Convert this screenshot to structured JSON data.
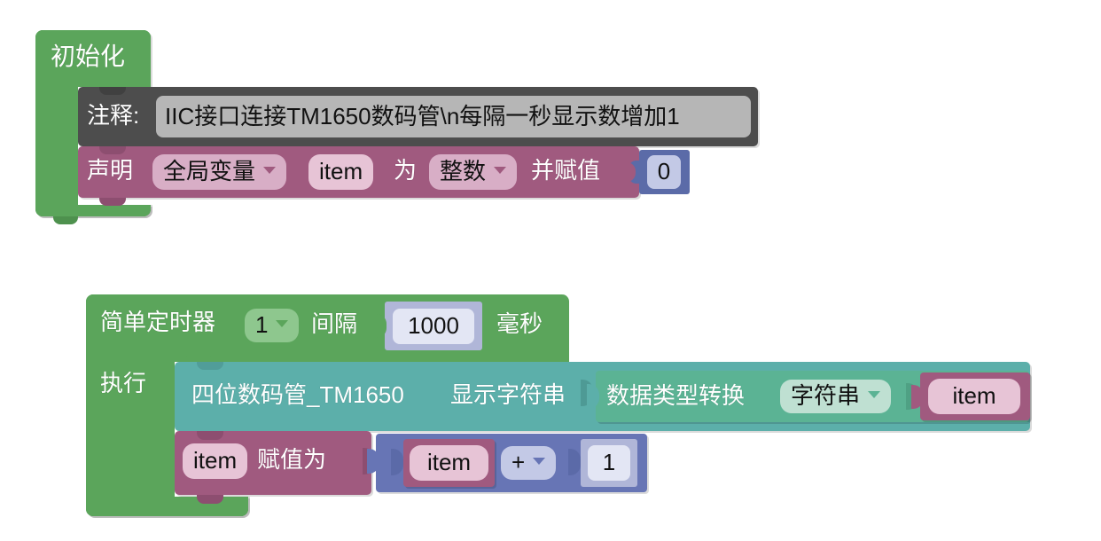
{
  "colors": {
    "event_green": "#5ba55b",
    "event_green_dark": "#4e914e",
    "comment_gray": "#4d4d4d",
    "comment_field": "#b6b6b6",
    "variable_pink": "#a05a7f",
    "variable_field": "#d8aec6",
    "math_blue": "#6775b5",
    "math_field": "#c3c9e6",
    "math_field_inner": "#dfe3f2",
    "device_teal": "#5cafaa",
    "convert_teal": "#5bb394",
    "convert_field": "#bfe0d2",
    "canvas_white": "#ffffff"
  },
  "init_block": {
    "title": "初始化",
    "comment_row": {
      "label": "注释:",
      "value": "IIC接口连接TM1650数码管\\n每隔一秒显示数增加1"
    },
    "declare_row": {
      "keyword": "声明",
      "scope": "全局变量",
      "var_name": "item",
      "as_label": "为",
      "type": "整数",
      "assign_label": "并赋值",
      "value": "0"
    }
  },
  "timer_block": {
    "title": "简单定时器",
    "timer_id": "1",
    "interval_label": "间隔",
    "interval_value": "1000",
    "unit_label": "毫秒",
    "do_label": "执行",
    "statements": [
      {
        "kind": "device-display",
        "device": "四位数码管_TM1650",
        "action": "显示字符串",
        "argument": {
          "kind": "type-convert",
          "label": "数据类型转换",
          "target_type": "字符串",
          "operand": "item"
        }
      },
      {
        "kind": "variable-set",
        "var_name": "item",
        "set_label": "赋值为",
        "expression": {
          "kind": "arithmetic",
          "left": "item",
          "operator": "+",
          "right": "1"
        }
      }
    ]
  }
}
